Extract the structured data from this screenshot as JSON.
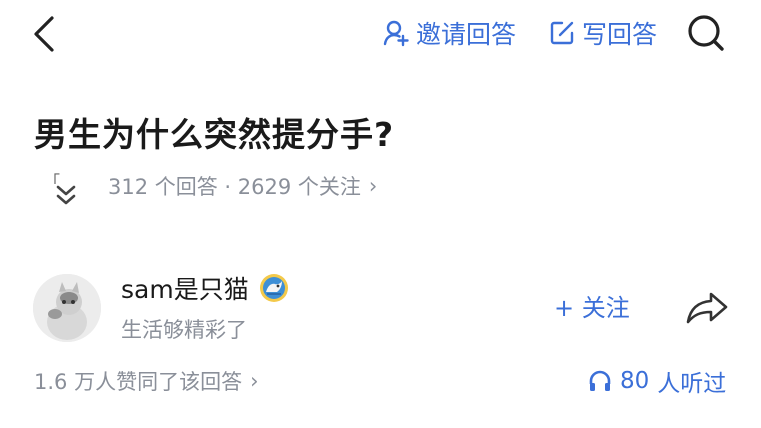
{
  "topbar": {
    "back_icon": "chevron-left-icon",
    "invite_label": "邀请回答",
    "write_label": "写回答",
    "search_icon": "search-icon"
  },
  "question": {
    "title": "男生为什么突然提分手?",
    "quote_mark": "「",
    "stats": "312 个回答 · 2629 个关注",
    "stats_chevron": "›"
  },
  "answer": {
    "author_name": "sam是只猫",
    "author_bio": "生活够精彩了",
    "follow_label": "+ 关注",
    "share_icon": "share-icon",
    "likes_text": "1.6 万人赞同了该回答",
    "likes_chevron": "›",
    "listen_count": "80",
    "listen_label": "人听过"
  },
  "colors": {
    "accent": "#3b6fd8",
    "secondary_text": "#8a8f99",
    "primary_text": "#1a1a1a"
  }
}
